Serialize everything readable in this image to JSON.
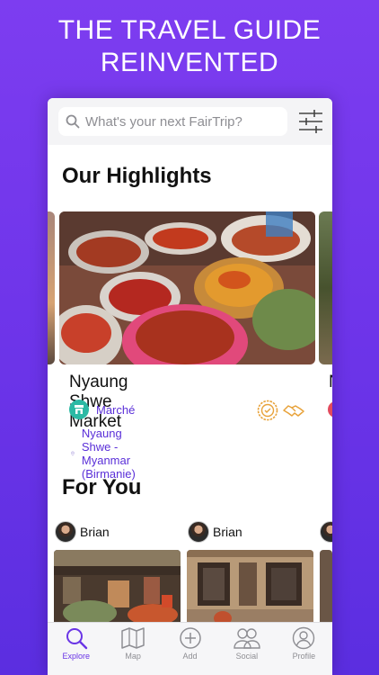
{
  "hero": {
    "line1": "THE TRAVEL GUIDE",
    "line2": "REINVENTED"
  },
  "search": {
    "placeholder": "What's your next FairTrip?"
  },
  "highlights": {
    "title": "Our Highlights",
    "place": {
      "name": "Nyaung Shwe Market",
      "category": "Marché",
      "location": "Nyaung Shwe - Myanmar (Birmanie)"
    },
    "next_place_initial": "N"
  },
  "for_you": {
    "title": "For You",
    "posts": [
      {
        "user": "Brian"
      },
      {
        "user": "Brian"
      }
    ]
  },
  "tabs": [
    {
      "label": "Explore",
      "icon": "search-icon",
      "active": true
    },
    {
      "label": "Map",
      "icon": "map-icon",
      "active": false
    },
    {
      "label": "Add",
      "icon": "add-icon",
      "active": false
    },
    {
      "label": "Social",
      "icon": "social-icon",
      "active": false
    },
    {
      "label": "Profile",
      "icon": "profile-icon",
      "active": false
    }
  ],
  "colors": {
    "accent": "#6a35e6",
    "background": "#7d3df0",
    "category_icon": "#2cb9a4",
    "badge": "#e8a23a"
  }
}
